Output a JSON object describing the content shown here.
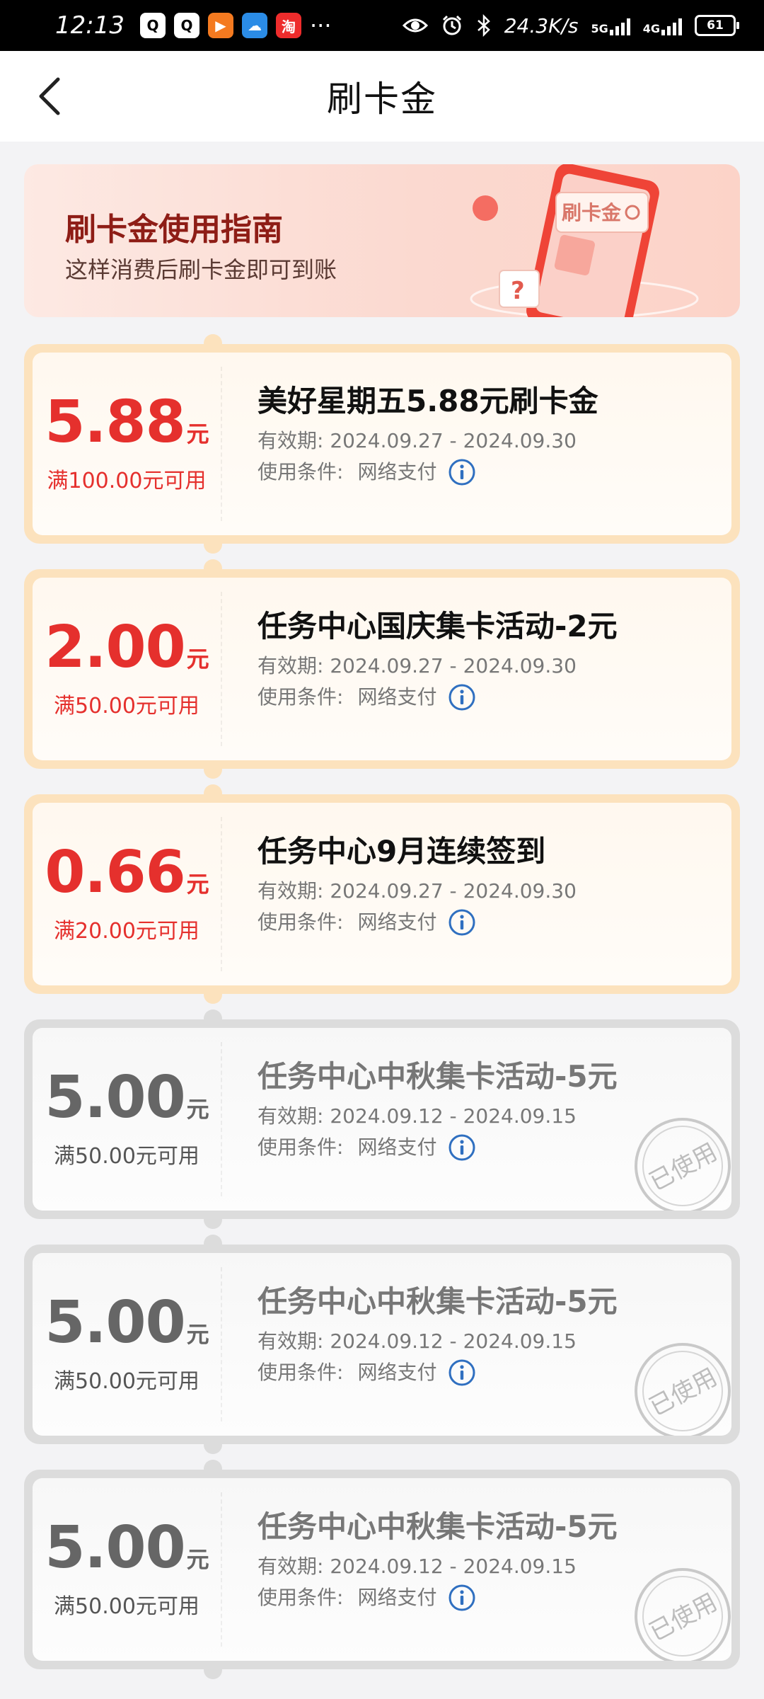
{
  "status_bar": {
    "time": "12:13",
    "network_speed": "24.3K/s",
    "signal_5g": "5G",
    "signal_4g": "4G",
    "battery": "61",
    "more": "···"
  },
  "header": {
    "title": "刷卡金"
  },
  "guide_banner": {
    "title": "刷卡金使用指南",
    "subtitle": "这样消费后刷卡金即可到账",
    "art_label": "刷卡金",
    "art_question": "?"
  },
  "labels": {
    "validity": "有效期:",
    "usage": "使用条件:",
    "unit": "元",
    "used_stamp": "已使用"
  },
  "coupons": [
    {
      "status": "active",
      "amount": "5.88",
      "condition": "满100.00元可用",
      "title": "美好星期五5.88元刷卡金",
      "validity": "2024.09.27 - 2024.09.30",
      "usage": "网络支付"
    },
    {
      "status": "active",
      "amount": "2.00",
      "condition": "满50.00元可用",
      "title": "任务中心国庆集卡活动-2元",
      "validity": "2024.09.27 - 2024.09.30",
      "usage": "网络支付"
    },
    {
      "status": "active",
      "amount": "0.66",
      "condition": "满20.00元可用",
      "title": "任务中心9月连续签到",
      "validity": "2024.09.27 - 2024.09.30",
      "usage": "网络支付"
    },
    {
      "status": "used",
      "amount": "5.00",
      "condition": "满50.00元可用",
      "title": "任务中心中秋集卡活动-5元",
      "validity": "2024.09.12 - 2024.09.15",
      "usage": "网络支付"
    },
    {
      "status": "used",
      "amount": "5.00",
      "condition": "满50.00元可用",
      "title": "任务中心中秋集卡活动-5元",
      "validity": "2024.09.12 - 2024.09.15",
      "usage": "网络支付"
    },
    {
      "status": "used",
      "amount": "5.00",
      "condition": "满50.00元可用",
      "title": "任务中心中秋集卡活动-5元",
      "validity": "2024.09.12 - 2024.09.15",
      "usage": "网络支付"
    }
  ],
  "colors": {
    "accent_red": "#e5302d",
    "active_border": "#fce2bd",
    "used_border": "#dcdcdc",
    "info_icon": "#2f6fc0"
  },
  "icons": {
    "back": "chevron-left-icon",
    "info": "info-icon",
    "eye": "eye-icon",
    "alarm": "alarm-icon",
    "bluetooth": "bluetooth-icon"
  }
}
